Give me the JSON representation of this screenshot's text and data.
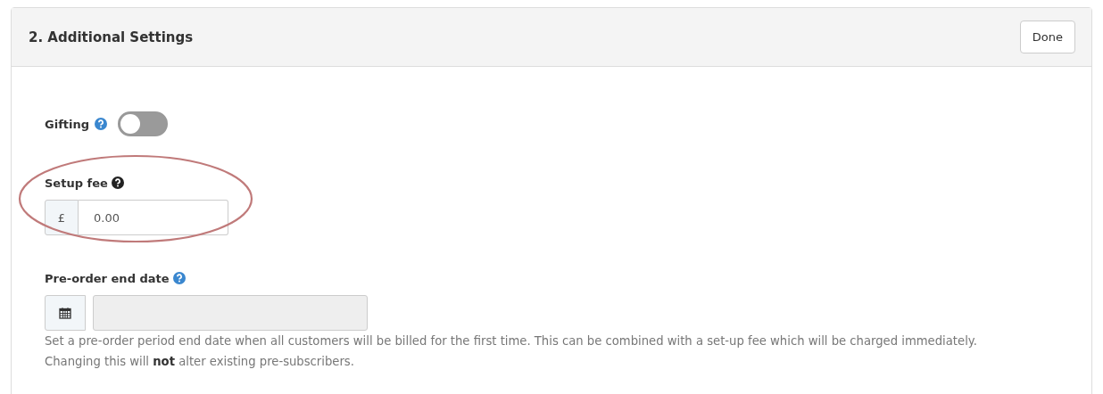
{
  "panel": {
    "title": "2. Additional Settings",
    "done_button": "Done"
  },
  "gifting": {
    "label": "Gifting",
    "on": false
  },
  "setup_fee": {
    "label": "Setup fee",
    "currency": "£",
    "value": "0.00",
    "circled": true
  },
  "preorder": {
    "label": "Pre-order end date",
    "disabled": true,
    "help_lines": [
      "Set a pre-order period end date when all customers will be billed for the first time. This can be combined with a set-up fee which will be charged immediately.",
      "Changing this will **not** alter existing pre-subscribers."
    ]
  }
}
